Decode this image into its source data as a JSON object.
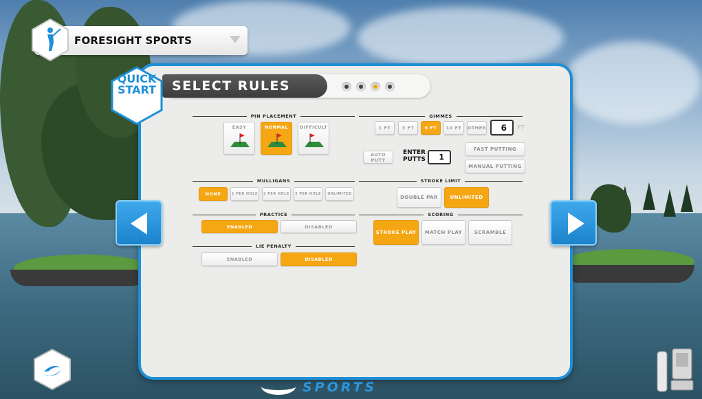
{
  "course": {
    "title": "FORESIGHT SPORTS"
  },
  "quick_start": {
    "line1": "QUICK",
    "line2": "START"
  },
  "header": {
    "title": "SELECT RULES",
    "steps": [
      false,
      false,
      true,
      false
    ]
  },
  "pin_placement": {
    "label": "PIN PLACEMENT",
    "options": [
      {
        "label": "EASY",
        "selected": false
      },
      {
        "label": "NORMAL",
        "selected": true
      },
      {
        "label": "DIFFICULT",
        "selected": false
      }
    ]
  },
  "gimmes": {
    "label": "GIMMES",
    "options": [
      {
        "label": "1 FT",
        "selected": false
      },
      {
        "label": "3 FT",
        "selected": false
      },
      {
        "label": "6 FT",
        "selected": true
      },
      {
        "label": "10 FT",
        "selected": false
      },
      {
        "label": "OTHER",
        "selected": false
      }
    ],
    "other_value": "6",
    "other_unit": "FT"
  },
  "putting": {
    "auto_putt": "AUTO PUTT",
    "enter_putts_line1": "ENTER",
    "enter_putts_line2": "PUTTS",
    "enter_putts_value": "1",
    "fast_putting": "FAST PUTTING",
    "manual_putting": "MANUAL PUTTING"
  },
  "mulligans": {
    "label": "MULLIGANS",
    "options": [
      {
        "label": "NONE",
        "selected": true
      },
      {
        "label": "1 PER HOLE",
        "selected": false
      },
      {
        "label": "2 PER HOLE",
        "selected": false
      },
      {
        "label": "3 PER HOLE",
        "selected": false
      },
      {
        "label": "UNLIMITED",
        "selected": false
      }
    ]
  },
  "stroke_limit": {
    "label": "STROKE LIMIT",
    "options": [
      {
        "label": "DOUBLE PAR",
        "selected": false
      },
      {
        "label": "UNLIMITED",
        "selected": true
      }
    ]
  },
  "practice": {
    "label": "PRACTICE",
    "options": [
      {
        "label": "ENABLED",
        "selected": true
      },
      {
        "label": "DISABLED",
        "selected": false
      }
    ]
  },
  "scoring": {
    "label": "SCORING",
    "options": [
      {
        "label": "STROKE PLAY",
        "selected": true
      },
      {
        "label": "MATCH PLAY",
        "selected": false
      },
      {
        "label": "SCRAMBLE",
        "selected": false
      }
    ]
  },
  "lie_penalty": {
    "label": "LIE PENALTY",
    "options": [
      {
        "label": "ENABLED",
        "selected": false
      },
      {
        "label": "DISABLED",
        "selected": true
      }
    ]
  },
  "footer": {
    "brand_text": "SPORTS"
  },
  "colors": {
    "accent": "#f5a613",
    "panel_border": "#1f8fd6",
    "arrow": "#2b97dc"
  }
}
